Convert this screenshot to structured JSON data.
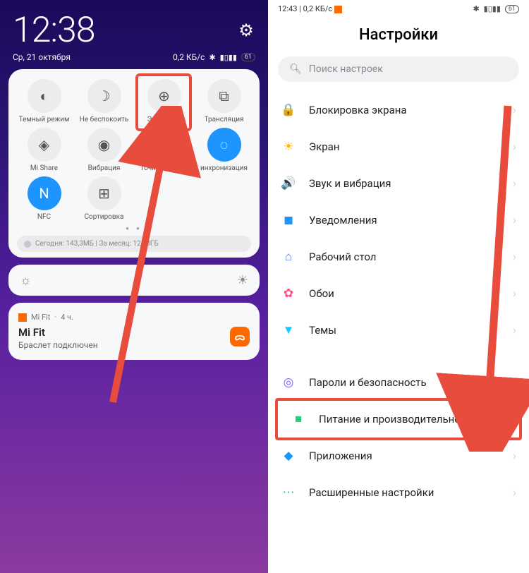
{
  "left": {
    "clock": "12:38",
    "date": "Ср, 21 октября",
    "net": "0,2 КБ/с",
    "battery": "61",
    "qs": [
      {
        "label": "Темный режим",
        "icon": "◐"
      },
      {
        "label": "Не беспокоить",
        "icon": "☽"
      },
      {
        "label": "Экономия",
        "icon": "⊕"
      },
      {
        "label": "Трансляция",
        "icon": "⧉"
      },
      {
        "label": "Mi Share",
        "icon": "◈"
      },
      {
        "label": "Вибрация",
        "icon": "◉"
      },
      {
        "label": "Точка доступа",
        "icon": "ᯤ"
      },
      {
        "label": "инхронизация",
        "icon": "◌",
        "active": true
      },
      {
        "label": "NFC",
        "icon": "N",
        "active": true
      },
      {
        "label": "Сортировка",
        "icon": "⊞"
      }
    ],
    "usage": "Сегодня: 143,3МБ   |   За месяц: 12,93ГБ",
    "notif": {
      "app": "Mi Fit",
      "time": "4 ч.",
      "title": "Mi Fit",
      "body": "Браслет подключен",
      "badge": "ᯅ"
    }
  },
  "right": {
    "status_time": "12:43",
    "status_net": "0,2 КБ/с",
    "battery": "61",
    "title": "Настройки",
    "search_ph": "Поиск настроек",
    "items": [
      {
        "label": "Блокировка экрана",
        "icon": "🔒",
        "cls": "ic-lock"
      },
      {
        "label": "Экран",
        "icon": "☀",
        "cls": "ic-screen"
      },
      {
        "label": "Звук и вибрация",
        "icon": "🔊",
        "cls": "ic-sound"
      },
      {
        "label": "Уведомления",
        "icon": "◼",
        "cls": "ic-notif"
      },
      {
        "label": "Рабочий стол",
        "icon": "⌂",
        "cls": "ic-home"
      },
      {
        "label": "Обои",
        "icon": "✿",
        "cls": "ic-wall"
      },
      {
        "label": "Темы",
        "icon": "▼",
        "cls": "ic-theme"
      }
    ],
    "items2": [
      {
        "label": "Пароли и безопасность",
        "icon": "◎",
        "cls": "ic-sec"
      },
      {
        "label": "Питание и производительность",
        "icon": "■",
        "cls": "ic-power",
        "highlight": true
      },
      {
        "label": "Приложения",
        "icon": "◆",
        "cls": "ic-apps"
      },
      {
        "label": "Расширенные настройки",
        "icon": "⋯",
        "cls": "ic-more"
      }
    ]
  }
}
